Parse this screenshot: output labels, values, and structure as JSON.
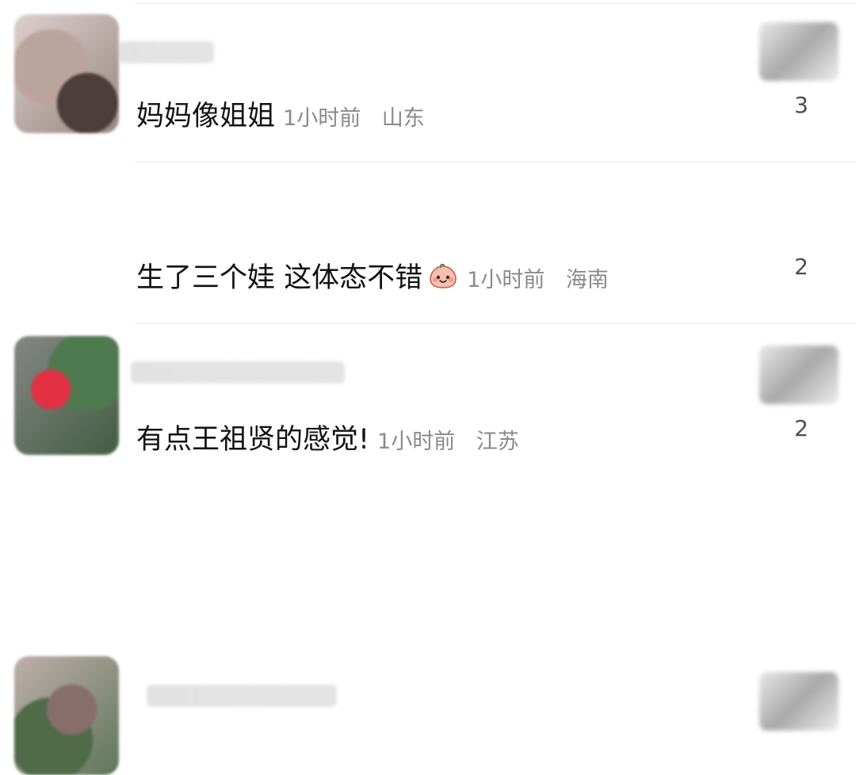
{
  "comments": [
    {
      "text": "妈妈像姐姐",
      "time": "1小时前",
      "location": "山东",
      "likes": "3",
      "emoji_icon": ""
    },
    {
      "text": "生了三个娃 这体态不错",
      "time": "1小时前",
      "location": "海南",
      "likes": "2",
      "emoji_icon": "smiling-peach-face-icon"
    },
    {
      "text": "有点王祖贤的感觉!",
      "time": "1小时前",
      "location": "江苏",
      "likes": "2",
      "emoji_icon": ""
    }
  ],
  "colors": {
    "comment_text": "#121212",
    "meta_text": "#8a8a8a",
    "like_text": "#4d4d4d",
    "divider": "#e9e9e9"
  }
}
